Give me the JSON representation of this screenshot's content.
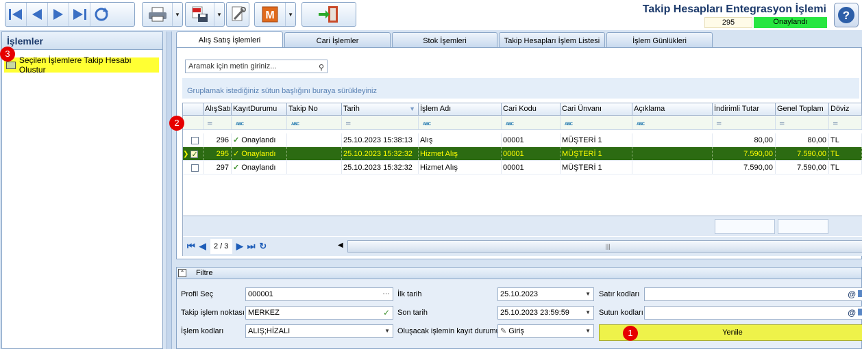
{
  "toolbar": {
    "title": "Takip Hesapları Entegrasyon İşlemi",
    "record_no": "295",
    "status": "Onaylandı"
  },
  "left_panel": {
    "title": "İşlemler",
    "item": "Seçilen İşlemlere Takip Hesabı Olustur"
  },
  "tabs": [
    "Alış Satış İşlemleri",
    "Cari İşlemler",
    "Stok İşemleri",
    "Takip Hesapları İşlem Listesi",
    "İşlem Günlükleri"
  ],
  "search": {
    "placeholder": "Aramak için metin giriniz..."
  },
  "group_hint": "Gruplamak istediğiniz sütun başlığını buraya sürükleyiniz",
  "grid": {
    "columns": [
      "AlışSatış",
      "KayıtDurumu",
      "Takip No",
      "Tarih",
      "İşlem Adı",
      "Cari Kodu",
      "Cari Ünvanı",
      "Açıklama",
      "İndirimli Tutar",
      "Genel Toplam",
      "Döviz"
    ],
    "rows": [
      {
        "id": "296",
        "status": "Onaylandı",
        "takip": "",
        "tarih": "25.10.2023 15:38:13",
        "islem": "Alış",
        "cari_kodu": "00001",
        "cari_unvan": "MÜŞTERİ 1",
        "aciklama": "",
        "indirimli": "80,00",
        "genel": "80,00",
        "doviz": "TL",
        "checked": false
      },
      {
        "id": "295",
        "status": "Onaylandı",
        "takip": "",
        "tarih": "25.10.2023 15:32:32",
        "islem": "Hizmet Alış",
        "cari_kodu": "00001",
        "cari_unvan": "MÜŞTERİ 1",
        "aciklama": "",
        "indirimli": "7.590,00",
        "genel": "7.590,00",
        "doviz": "TL",
        "checked": true
      },
      {
        "id": "297",
        "status": "Onaylandı",
        "takip": "",
        "tarih": "25.10.2023 15:32:32",
        "islem": "Hizmet Alış",
        "cari_kodu": "00001",
        "cari_unvan": "MÜŞTERİ 1",
        "aciklama": "",
        "indirimli": "7.590,00",
        "genel": "7.590,00",
        "doviz": "TL",
        "checked": false
      }
    ],
    "page": "2 / 3"
  },
  "filter": {
    "title": "Filtre",
    "profil_label": "Profil Seç",
    "profil_value": "000001",
    "takip_label": "Takip işlem noktası",
    "takip_value": "MERKEZ",
    "islem_kod_label": "İşlem kodları",
    "islem_kod_value": "ALIŞ;HİZALI",
    "ilk_tarih_label": "İlk tarih",
    "ilk_tarih_value": "25.10.2023",
    "son_tarih_label": "Son tarih",
    "son_tarih_value": "25.10.2023 23:59:59",
    "kayit_durum_label": "Oluşacak işlemin kayıt durumu",
    "kayit_durum_value": "Giriş",
    "satir_label": "Satır kodları",
    "sutun_label": "Sutun kodları",
    "yenile_label": "Yenile"
  },
  "badges": [
    "1",
    "2",
    "3"
  ],
  "colors": {
    "selected_row": "#2c6b12",
    "status_ok": "#27e640",
    "highlight": "#ffff33",
    "badge": "#e60000"
  }
}
